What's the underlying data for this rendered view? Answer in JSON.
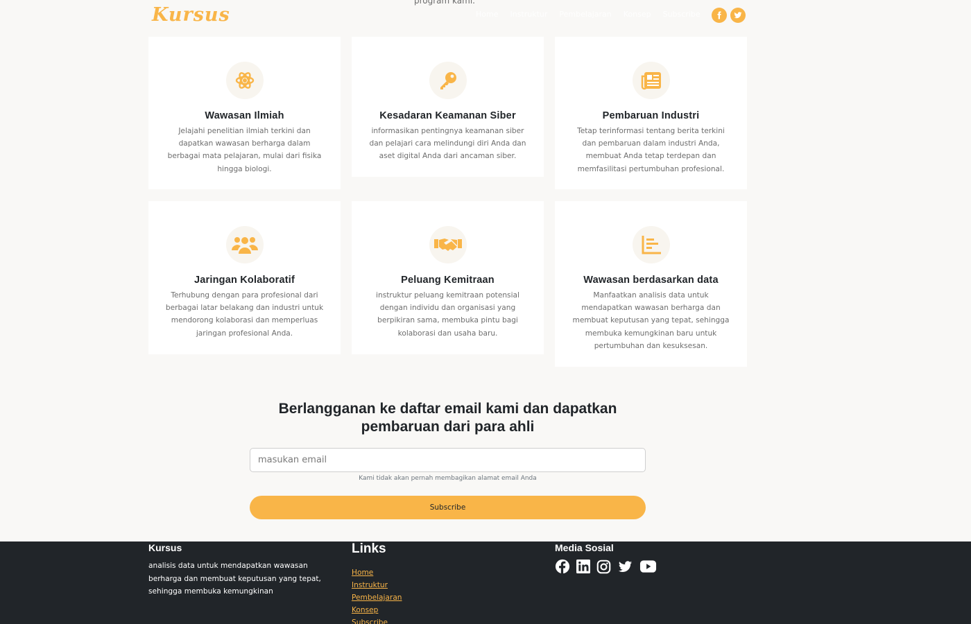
{
  "header": {
    "brand": "Kursus",
    "intro_tail": "program kami.",
    "nav": [
      "Home",
      "Instruktur",
      "Pembelajaran",
      "Konsep",
      "Subscribe"
    ]
  },
  "features": [
    {
      "icon": "atom-icon",
      "title": "Wawasan Ilmiah",
      "text": "Jelajahi penelitian ilmiah terkini dan dapatkan wawasan berharga dalam berbagai mata pelajaran, mulai dari fisika hingga biologi."
    },
    {
      "icon": "key-icon",
      "title": "Kesadaran Keamanan Siber",
      "text": "informasikan pentingnya keamanan siber dan pelajari cara melindungi diri Anda dan aset digital Anda dari ancaman siber."
    },
    {
      "icon": "newspaper-icon",
      "title": "Pembaruan Industri",
      "text": "Tetap terinformasi tentang berita terkini dan pembaruan dalam industri Anda, membuat Anda tetap terdepan dan memfasilitasi pertumbuhan profesional."
    },
    {
      "icon": "people-icon",
      "title": "Jaringan Kolaboratif",
      "text": "Terhubung dengan para profesional dari berbagai latar belakang dan industri untuk mendorong kolaborasi dan memperluas jaringan profesional Anda."
    },
    {
      "icon": "handshake-icon",
      "title": "Peluang Kemitraan",
      "text": "instruktur peluang kemitraan potensial dengan individu dan organisasi yang berpikiran sama, membuka pintu bagi kolaborasi dan usaha baru."
    },
    {
      "icon": "bar-chart-icon",
      "title": "Wawasan berdasarkan data",
      "text": "Manfaatkan analisis data untuk mendapatkan wawasan berharga dan membuat keputusan yang tepat, sehingga membuka kemungkinan baru untuk pertumbuhan dan kesuksesan."
    }
  ],
  "subscribe": {
    "title": "Berlangganan ke daftar email kami dan dapatkan pembaruan dari para ahli",
    "placeholder": "masukan email",
    "hint": "Kami tidak akan pernah membagikan alamat email Anda",
    "button": "Subscribe"
  },
  "footer": {
    "brand": "Kursus",
    "description": "analisis data untuk mendapatkan wawasan berharga dan membuat keputusan yang tepat, sehingga membuka kemungkinan",
    "links_title": "Links",
    "links": [
      "Home",
      "Instruktur",
      "Pembelajaran",
      "Konsep",
      "Subscribe"
    ],
    "social_title": "Media Sosial",
    "social_icons": [
      "facebook-icon",
      "linkedin-icon",
      "instagram-icon",
      "twitter-icon",
      "youtube-icon"
    ]
  },
  "colors": {
    "accent": "#f9b548",
    "footer_bg": "#212529",
    "page_bg": "#f9f8f6"
  }
}
